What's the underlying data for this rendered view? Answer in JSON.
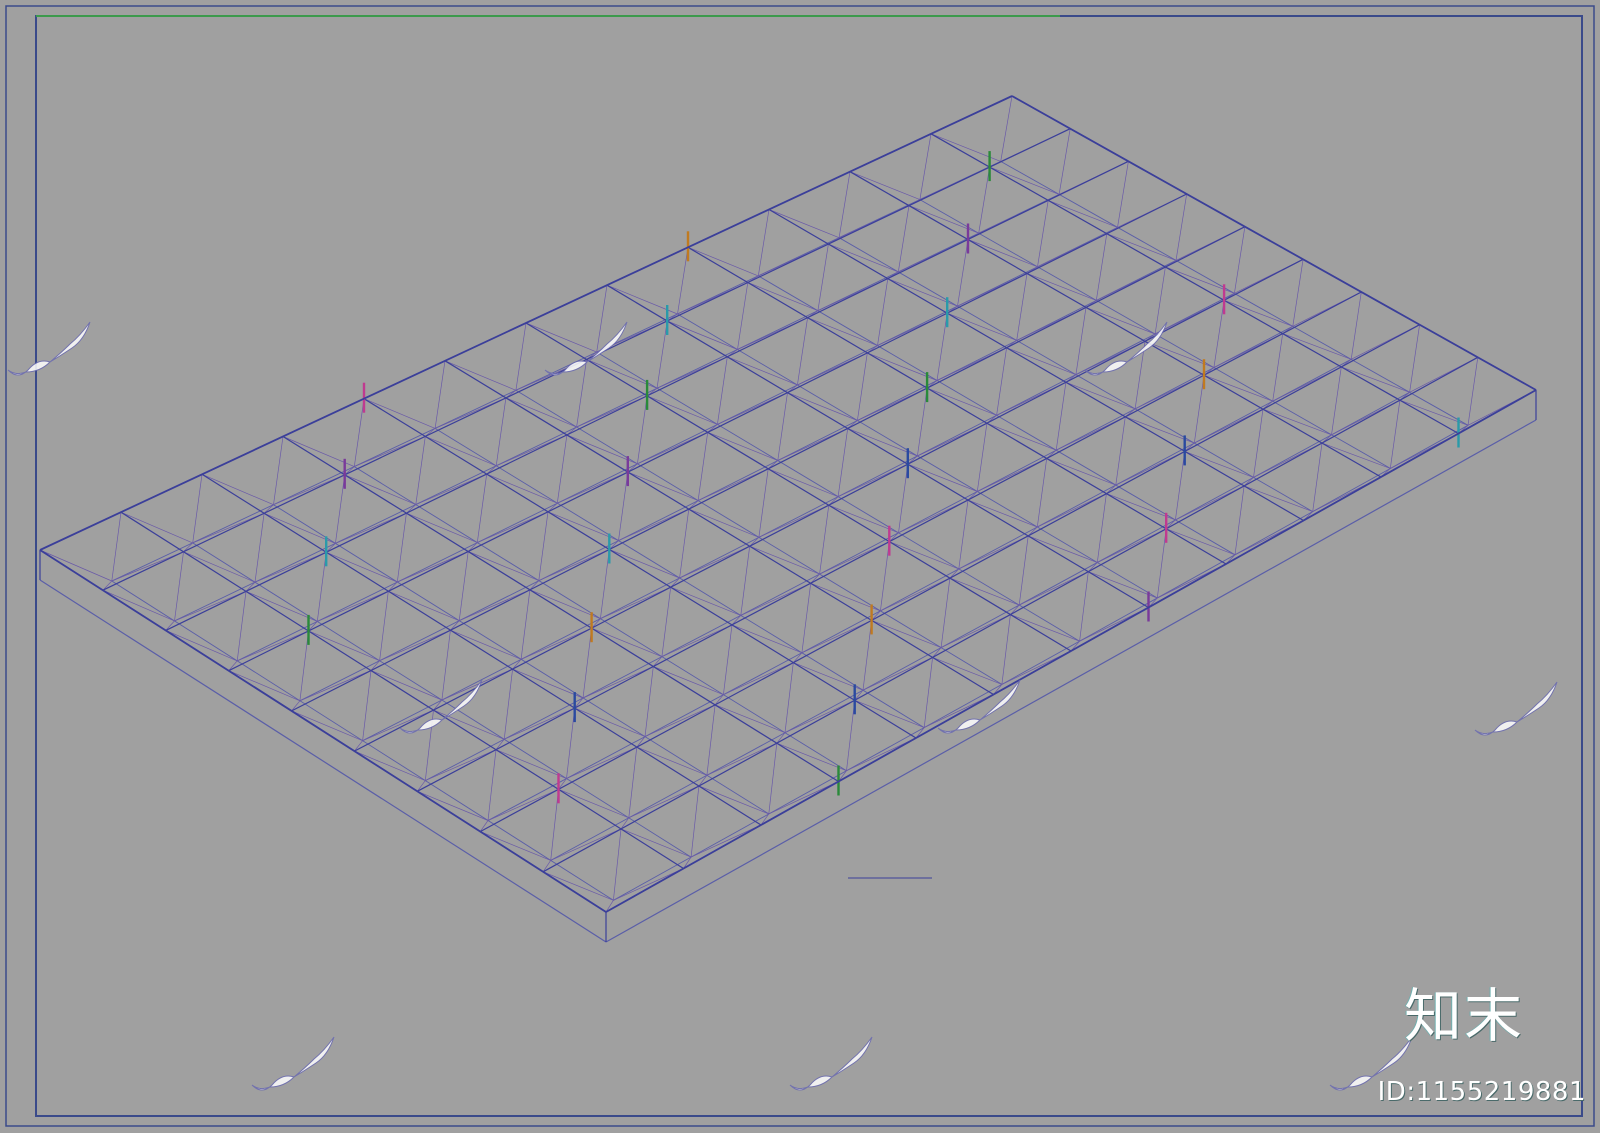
{
  "drawing": {
    "caption": "",
    "grid_cols": 12,
    "grid_rows": 9
  },
  "watermark": {
    "brand": "知末",
    "id_text": "ID:1155219881"
  },
  "colors": {
    "background": "#a0a0a0",
    "frame": "#3a4a8a",
    "frame_top": "#3c9a4c",
    "member_primary": "#3b3f9a",
    "member_accents": [
      "#2a8a3a",
      "#c03a90",
      "#2a9aaa",
      "#2a4aa0",
      "#7a3a9a",
      "#c07a20"
    ]
  }
}
